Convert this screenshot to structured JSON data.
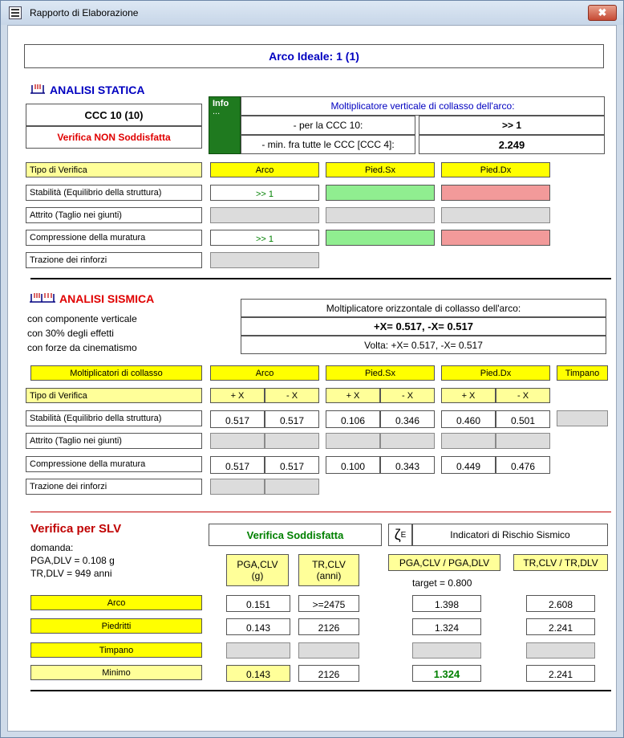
{
  "window": {
    "title": "Rapporto di Elaborazione",
    "close_glyph": "✖"
  },
  "header": {
    "arch_title": "Arco Ideale: 1 (1)"
  },
  "static": {
    "title": "ANALISI STATICA",
    "ccc": "CCC 10 (10)",
    "status": "Verifica NON Soddisfatta",
    "info_label": "Info",
    "info_dots": "...",
    "mult_title": "Moltiplicatore verticale di collasso dell'arco:",
    "row1_label": "- per la CCC 10:",
    "row1_value": ">> 1",
    "row2_label": "- min. fra tutte le CCC [CCC 4]:",
    "row2_value": "2.249",
    "col_type": "Tipo di Verifica",
    "col_arco": "Arco",
    "col_sx": "Pied.Sx",
    "col_dx": "Pied.Dx",
    "rows": [
      "Stabilità (Equilibrio della struttura)",
      "Attrito (Taglio nei giunti)",
      "Compressione della muratura",
      "Trazione dei rinforzi"
    ],
    "stab_arco": ">> 1",
    "comp_arco": ">> 1"
  },
  "seismic": {
    "title": "ANALISI SISMICA",
    "desc1": "con componente verticale",
    "desc2": "con 30% degli effetti",
    "desc3": "con forze da cinematismo",
    "mult_title": "Moltiplicatore orizzontale di collasso dell'arco:",
    "mult_value": "+X= 0.517, -X= 0.517",
    "volta": "Volta: +X= 0.517, -X= 0.517",
    "col_mult": "Moltiplicatori di collasso",
    "col_arco": "Arco",
    "col_sx": "Pied.Sx",
    "col_dx": "Pied.Dx",
    "col_timpano": "Timpano",
    "col_type": "Tipo di Verifica",
    "plus_x": "+ X",
    "minus_x": "- X",
    "rows": [
      "Stabilità (Equilibrio della struttura)",
      "Attrito (Taglio nei giunti)",
      "Compressione della muratura",
      "Trazione dei rinforzi"
    ],
    "stab": [
      "0.517",
      "0.517",
      "0.106",
      "0.346",
      "0.460",
      "0.501"
    ],
    "comp": [
      "0.517",
      "0.517",
      "0.100",
      "0.343",
      "0.449",
      "0.476"
    ]
  },
  "slv": {
    "title": "Verifica per SLV",
    "domanda": "domanda:",
    "pga_dlv": "PGA,DLV = 0.108 g",
    "tr_dlv": "TR,DLV = 949 anni",
    "status": "Verifica Soddisfatta",
    "zeta": "ζ",
    "zeta_sub": "E",
    "risk_title": "Indicatori di Rischio Sismico",
    "h_pga1": "PGA,CLV",
    "h_pga2": "(g)",
    "h_tr1": "TR,CLV",
    "h_tr2": "(anni)",
    "h_ratio_pga": "PGA,CLV / PGA,DLV",
    "h_ratio_tr": "TR,CLV / TR,DLV",
    "target": "target = 0.800",
    "rows": [
      {
        "label": "Arco",
        "pga": "0.151",
        "tr": ">=2475",
        "rpga": "1.398",
        "rtr": "2.608"
      },
      {
        "label": "Piedritti",
        "pga": "0.143",
        "tr": "2126",
        "rpga": "1.324",
        "rtr": "2.241"
      },
      {
        "label": "Timpano",
        "pga": "",
        "tr": "",
        "rpga": "",
        "rtr": ""
      },
      {
        "label": "Minimo",
        "pga": "0.143",
        "tr": "2126",
        "rpga": "1.324",
        "rtr": "2.241"
      }
    ]
  },
  "colors": {
    "blue": "#0000c0",
    "red": "#e00000",
    "darkred": "#c00000",
    "green": "#008000",
    "info_green": "#1f7a1f"
  },
  "icons": {
    "window": "window-grid-icon",
    "static": "arch-icon",
    "seismic": "double-arch-icon"
  }
}
